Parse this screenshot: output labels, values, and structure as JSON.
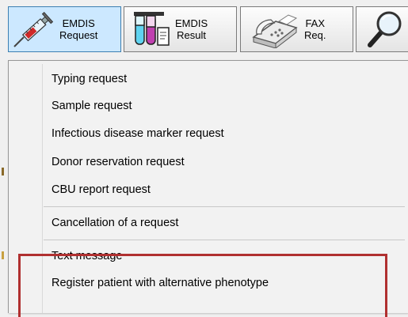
{
  "toolbar": {
    "buttons": [
      {
        "line1": "EMDIS",
        "line2": "Request",
        "icon": "syringe-icon"
      },
      {
        "line1": "EMDIS",
        "line2": "Result",
        "icon": "test-tubes-icon"
      },
      {
        "line1": "FAX",
        "line2": "Req.",
        "icon": "fax-machine-icon"
      },
      {
        "icon": "magnifier-icon"
      }
    ]
  },
  "menu": {
    "items": [
      "Typing request",
      "Sample request",
      "Infectious disease marker request",
      "Donor reservation request",
      "CBU report request",
      "Cancellation of a request",
      "Text message",
      "Register patient with alternative phenotype"
    ]
  },
  "colors": {
    "highlight_border": "#b03030",
    "pressed_button_bg": "#cce8ff"
  }
}
